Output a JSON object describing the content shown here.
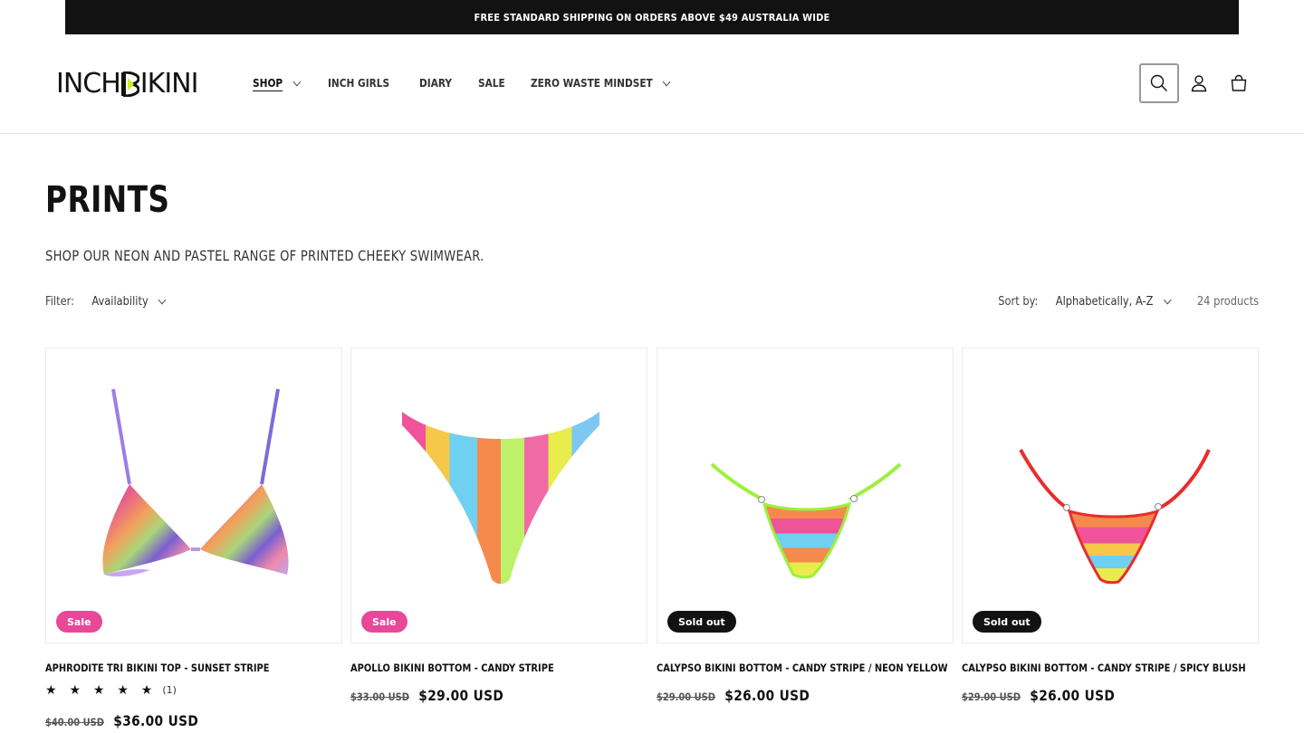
{
  "announcement": "FREE STANDARD SHIPPING ON ORDERS ABOVE $49 AUSTRALIA WIDE",
  "logo": {
    "left": "INCH",
    "right": "IKINI",
    "accent_color": "#c8f01e"
  },
  "nav": [
    {
      "label": "SHOP",
      "dropdown": true,
      "active": true
    },
    {
      "label": "INCH GIRLS",
      "dropdown": false
    },
    {
      "label": "DIARY",
      "dropdown": false
    },
    {
      "label": "SALE",
      "dropdown": false
    },
    {
      "label": "ZERO WASTE MINDSET",
      "dropdown": true
    }
  ],
  "header_icons": [
    "search-icon",
    "account-icon",
    "cart-icon"
  ],
  "collection": {
    "title": "PRINTS",
    "description": "SHOP OUR NEON AND PASTEL RANGE OF PRINTED CHEEKY SWIMWEAR."
  },
  "facets": {
    "filter_label": "Filter:",
    "availability": "Availability",
    "sort_label": "Sort by:",
    "sort_value": "Alphabetically, A-Z",
    "count": "24 products"
  },
  "colors": {
    "sale_badge": "#e8479a",
    "sold_badge": "#121212",
    "text": "#121212"
  },
  "products": [
    {
      "name": "APHRODITE TRI BIKINI TOP - SUNSET STRIPE",
      "badge": "Sale",
      "badge_type": "sale",
      "rating": "★ ★ ★ ★ ★",
      "rating_count": "(1)",
      "price_old": "$40.00 USD",
      "price_new": "$36.00 USD"
    },
    {
      "name": "APOLLO BIKINI BOTTOM - CANDY STRIPE",
      "badge": "Sale",
      "badge_type": "sale",
      "price_old": "$33.00 USD",
      "price_new": "$29.00 USD"
    },
    {
      "name": "CALYPSO BIKINI BOTTOM - CANDY STRIPE / NEON YELLOW",
      "badge": "Sold out",
      "badge_type": "sold",
      "price_old": "$29.00 USD",
      "price_new": "$26.00 USD"
    },
    {
      "name": "CALYPSO BIKINI BOTTOM - CANDY STRIPE / SPICY BLUSH",
      "badge": "Sold out",
      "badge_type": "sold",
      "price_old": "$29.00 USD",
      "price_new": "$26.00 USD"
    }
  ]
}
